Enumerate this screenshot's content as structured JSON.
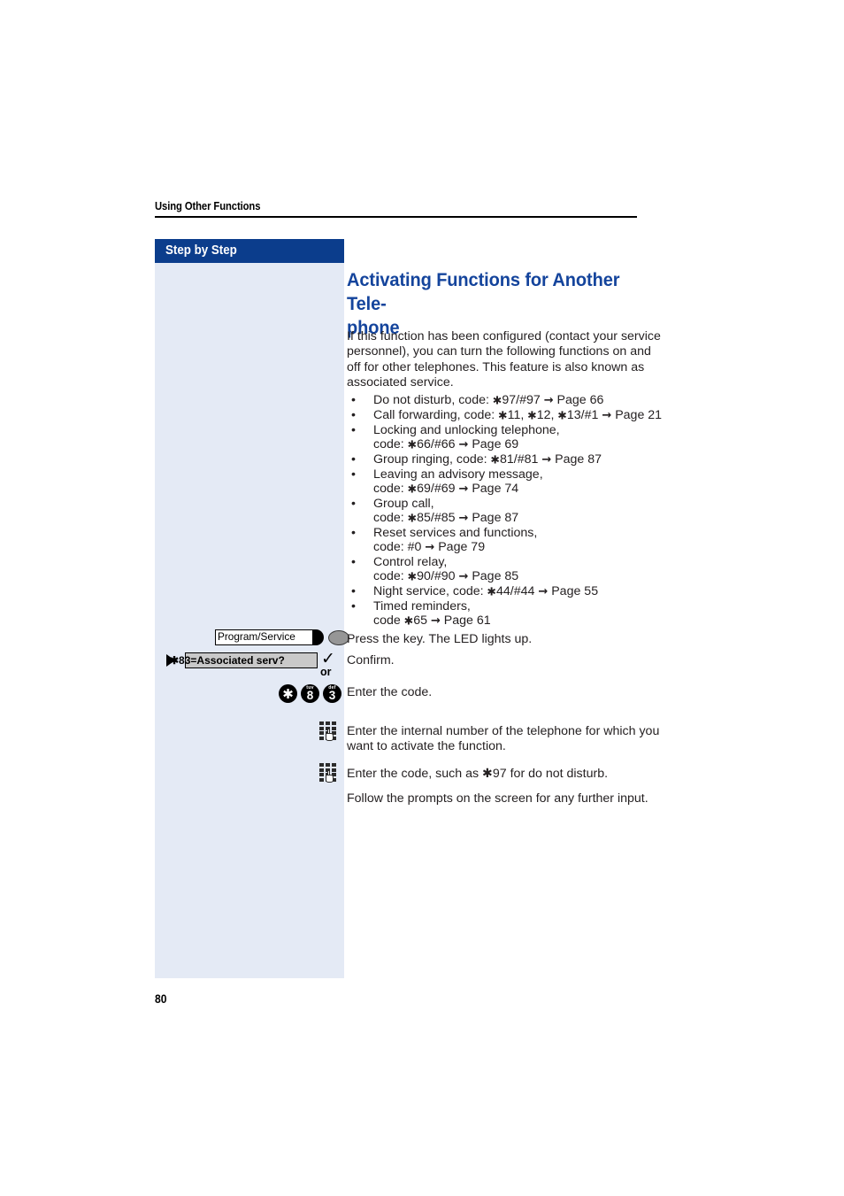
{
  "header": {
    "running_title": "Using Other Functions"
  },
  "sidebar": {
    "title": "Step by Step"
  },
  "main": {
    "heading": "Activating Functions for Another Tele-phone",
    "intro": "If this function has been configured (contact your service personnel), you can turn the following functions on and off for other telephones. This feature is also known as associated service.",
    "bullets": [
      {
        "line1": "Do not disturb, code: ✱ 97/#97 → Page 66",
        "line2": ""
      },
      {
        "line1": "Call forwarding, code: ✱11, ✱12, ✱13/#1 → Page 21",
        "line2": ""
      },
      {
        "line1": "Locking and unlocking telephone,",
        "line2": "code: ✱66/#66 → Page 69"
      },
      {
        "line1": "Group ringing, code: ✱81/#81 → Page 87",
        "line2": ""
      },
      {
        "line1": "Leaving an advisory message,",
        "line2": "code: ✱69/#69 → Page 74"
      },
      {
        "line1": "Group call,",
        "line2": "code: ✱85/#85 → Page 87"
      },
      {
        "line1": "Reset services and functions,",
        "line2": "code: #0 → Page 79"
      },
      {
        "line1": "Control relay,",
        "line2": "code: ✱90/#90 → Page 85"
      },
      {
        "line1": "Night service, code: ✱44/#44 → Page 55",
        "line2": ""
      },
      {
        "line1": "Timed reminders,",
        "line2": "code ✱65 → Page 61"
      }
    ],
    "bullet_marker": "•",
    "steps": [
      {
        "text": "Press the key. The LED lights up."
      },
      {
        "text": "Confirm."
      },
      {
        "text": "Enter the code."
      },
      {
        "text": "Enter the internal number of the telephone for which you want to activate the function."
      },
      {
        "text": "Enter the code, such as ✱97 for do not disturb."
      },
      {
        "text": "Follow the prompts on the screen for any further input."
      }
    ]
  },
  "controls": {
    "function_key_label": "Program/Service",
    "menu_option_label": "✱83=Associated serv?",
    "or_label": "or",
    "check_glyph": "✓",
    "keys": [
      {
        "main": "✱",
        "sub": ""
      },
      {
        "main": "8",
        "sub": "tuv"
      },
      {
        "main": "3",
        "sub": "def"
      }
    ]
  },
  "footer": {
    "page_number": "80"
  },
  "colors": {
    "sidebar_header_bg": "#0b3d8c",
    "sidebar_bg": "#e4eaf5",
    "heading_blue": "#14449c",
    "body_text": "#231f20",
    "menu_box_bg": "#c9c9c9",
    "led_gray": "#969696"
  }
}
